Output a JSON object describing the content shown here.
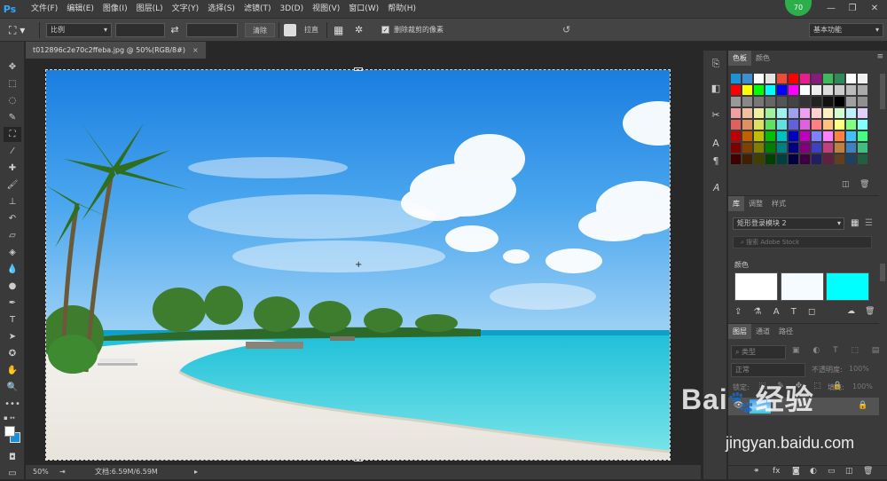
{
  "app": {
    "logo": "Ps",
    "badge": "70"
  },
  "menu": [
    "文件(F)",
    "编辑(E)",
    "图像(I)",
    "图层(L)",
    "文字(Y)",
    "选择(S)",
    "滤镜(T)",
    "3D(D)",
    "视图(V)",
    "窗口(W)",
    "帮助(H)"
  ],
  "options": {
    "ratio": "比例",
    "clear": "清除",
    "straighten": "拉直",
    "delete_cropped_label": "删除裁剪的像素",
    "delete_cropped_checked": true,
    "workspace": "基本功能"
  },
  "document": {
    "tab_title": "t012896c2e70c2ffeba.jpg @ 50%(RGB/8#)",
    "close": "×"
  },
  "status": {
    "zoom": "50%",
    "doc_size": "文档:6.59M/6.59M"
  },
  "color_panel": {
    "tabs": [
      "色板",
      "颜色"
    ]
  },
  "swatches": {
    "row0": [
      "#1b93d6",
      "#3e8fd0",
      "#ffffff",
      "#e4e4e4",
      "#ee4b3a",
      "#ff0000",
      "#e91e8c",
      "#8b1a7d",
      "#3cbb5a",
      "#2e8b57",
      "#ffffff",
      "#f0f0f0",
      "#b5b5b5",
      "#c39bd3",
      "#9b59b6",
      "#8e44ad"
    ],
    "rows": [
      [
        "#ff0000",
        "#ffff00",
        "#00ff00",
        "#00ffff",
        "#0000ff",
        "#ff00ff",
        "#ffffff",
        "#eeeeee",
        "#dddddd",
        "#cccccc",
        "#bbbbbb",
        "#aaaaaa"
      ],
      [
        "#999999",
        "#888888",
        "#777777",
        "#666666",
        "#555555",
        "#444444",
        "#333333",
        "#222222",
        "#111111",
        "#000000",
        "#a0a0a0",
        "#909090"
      ],
      [
        "#f0a0a0",
        "#f0c0a0",
        "#f0f0a0",
        "#a0f0a0",
        "#a0f0f0",
        "#a0a0f0",
        "#f0a0f0",
        "#ffd0d0",
        "#fff0c0",
        "#d0ffd0",
        "#c0f0ff",
        "#e0d0ff"
      ],
      [
        "#e06060",
        "#e09060",
        "#e0e060",
        "#60e060",
        "#60e0e0",
        "#6060e0",
        "#e060e0",
        "#ff8080",
        "#ffc080",
        "#ffff80",
        "#80ff80",
        "#80ffff"
      ],
      [
        "#c00000",
        "#c06000",
        "#c0c000",
        "#00c000",
        "#00c0c0",
        "#0000c0",
        "#c000c0",
        "#8080ff",
        "#ff80ff",
        "#ff8040",
        "#40c0ff",
        "#40ff80"
      ],
      [
        "#800000",
        "#804000",
        "#808000",
        "#008000",
        "#008080",
        "#000080",
        "#800080",
        "#4040c0",
        "#c04080",
        "#c08040",
        "#4080c0",
        "#40c080"
      ],
      [
        "#400000",
        "#402000",
        "#404000",
        "#004000",
        "#004040",
        "#000040",
        "#400040",
        "#202060",
        "#602040",
        "#604020",
        "#204060",
        "#206040"
      ]
    ]
  },
  "library": {
    "tabs": [
      "库",
      "调整",
      "样式"
    ],
    "selected": "矩形登录模块 2",
    "search_placeholder": "搜索 Adobe Stock",
    "color_label": "颜色",
    "colors": [
      "#ffffff",
      "#f5fbff",
      "#00ffff"
    ]
  },
  "layers": {
    "tabs": [
      "图层",
      "通道",
      "路径"
    ],
    "kind": "类型",
    "mode": "正常",
    "opacity_label": "不透明度:",
    "opacity": "100%",
    "lock_label": "锁定:",
    "fill_label": "填充:",
    "fill": "100%"
  },
  "watermark": {
    "brand": "Bai",
    "brand2": "经验",
    "url": "jingyan.baidu.com"
  }
}
